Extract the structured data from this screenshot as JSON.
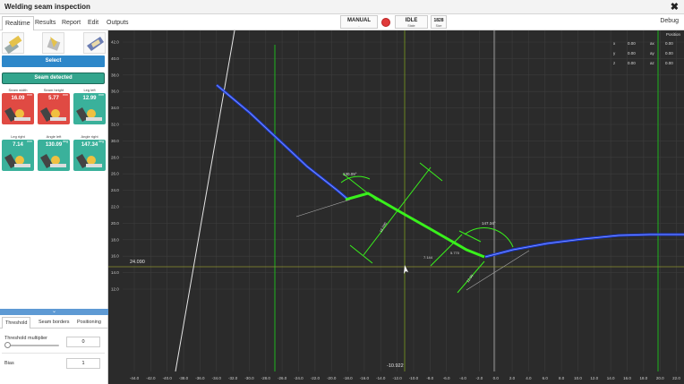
{
  "window": {
    "title": "Welding seam inspection",
    "close": "✖"
  },
  "menu": {
    "tabs": [
      "Realtime",
      "Results",
      "Report",
      "Edit",
      "Outputs"
    ],
    "mode": {
      "label": "MANUAL",
      "sub": "-"
    },
    "state": {
      "label": "IDLE",
      "sub": "State"
    },
    "size": {
      "label": "1828",
      "sub": "Size"
    },
    "debug": "Debug"
  },
  "left": {
    "select_label": "Select",
    "seam_label": "Seam detected",
    "divider_glyph": "⌄",
    "tiles": [
      {
        "label": "Seam width",
        "value": "16.09",
        "unit": "mm",
        "color": "#e04a43"
      },
      {
        "label": "Seam height",
        "value": "5.77",
        "unit": "mm",
        "color": "#e04a43"
      },
      {
        "label": "Leg left",
        "value": "12.99",
        "unit": "mm",
        "color": "#3ab19b"
      },
      {
        "label": "Leg right",
        "value": "7.14",
        "unit": "mm",
        "color": "#3ab19b"
      },
      {
        "label": "Angle left",
        "value": "130.09",
        "unit": "deg",
        "color": "#3ab19b"
      },
      {
        "label": "Angle right",
        "value": "147.34",
        "unit": "deg",
        "color": "#3ab19b"
      }
    ],
    "subtabs": [
      "Threshold",
      "Seam borders",
      "Positioning"
    ],
    "params": [
      {
        "label": "Threshold multiplier",
        "value": "0"
      },
      {
        "label": "Bias",
        "value": "1"
      }
    ]
  },
  "position": {
    "title": "Position",
    "rows": [
      {
        "axis": "x",
        "val": "0.00",
        "raxis": "ax",
        "rval": "0.00"
      },
      {
        "axis": "y",
        "val": "0.00",
        "raxis": "ay",
        "rval": "0.00"
      },
      {
        "axis": "z",
        "val": "0.00",
        "raxis": "az",
        "rval": "0.00"
      }
    ]
  },
  "plot": {
    "readout_y": "24.090",
    "readout_x": "-10.922",
    "angle_left_label": "130.09°",
    "angle_right_label": "147.34°",
    "width_label": "16.090",
    "height_label": "5.770",
    "leg_right_label": "7.144",
    "leg_left_label": "12.99",
    "x_ticks": [
      "-44.0",
      "-42.0",
      "-40.0",
      "-38.0",
      "-36.0",
      "-34.0",
      "-32.0",
      "-30.0",
      "-28.0",
      "-26.0",
      "-24.0",
      "-22.0",
      "-20.0",
      "-18.0",
      "-16.0",
      "-14.0",
      "-12.0",
      "-10.0",
      "-8.0",
      "-6.0",
      "-4.0",
      "-2.0",
      "0.0",
      "2.0",
      "4.0",
      "6.0",
      "8.0",
      "10.0",
      "12.0",
      "14.0",
      "16.0",
      "18.0",
      "20.0",
      "22.0"
    ],
    "y_ticks": [
      "42.0",
      "40.0",
      "38.0",
      "36.0",
      "34.0",
      "32.0",
      "30.0",
      "28.0",
      "26.0",
      "24.0",
      "22.0",
      "20.0",
      "18.0",
      "16.0",
      "14.0",
      "12.0"
    ],
    "profile_color": "#1a3ad8",
    "seam_color": "#39f11c"
  }
}
